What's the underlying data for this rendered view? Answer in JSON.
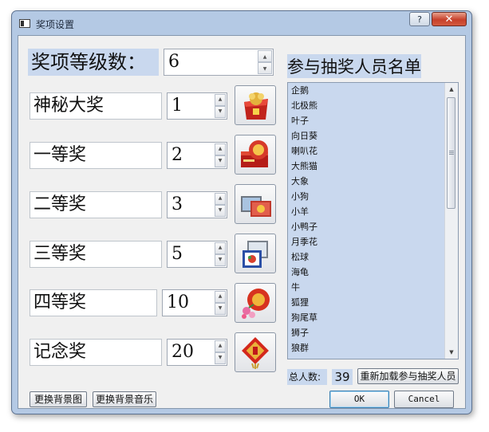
{
  "window": {
    "title": "奖项设置",
    "help": "?",
    "close": "✕"
  },
  "levels": {
    "label": "奖项等级数：",
    "value": "6"
  },
  "prizes": [
    {
      "name": "神秘大奖",
      "count": "1",
      "icon": "gift-basket-icon"
    },
    {
      "name": "一等奖",
      "count": "2",
      "icon": "red-envelope-icon"
    },
    {
      "name": "二等奖",
      "count": "3",
      "icon": "tv-set-icon"
    },
    {
      "name": "三等奖",
      "count": "5",
      "icon": "photo-frame-icon"
    },
    {
      "name": "四等奖",
      "count": "10",
      "icon": "red-ball-flowers-icon"
    },
    {
      "name": "记念奖",
      "count": "20",
      "icon": "fu-charm-icon"
    }
  ],
  "participants": {
    "title": "参与抽奖人员名单",
    "names": [
      "企鹅",
      "北极熊",
      "叶子",
      "向日葵",
      "喇叭花",
      "大熊猫",
      "大象",
      "小狗",
      "小羊",
      "小鸭子",
      "月季花",
      "松球",
      "海龟",
      "牛",
      "狐狸",
      "狗尾草",
      "狮子",
      "狼群"
    ],
    "total_label": "总人数:",
    "total_value": "39",
    "reload_button": "重新加载参与抽奖人员"
  },
  "buttons": {
    "change_background": "更换背景图",
    "change_music": "更换背景音乐",
    "ok": "OK",
    "cancel": "Cancel"
  },
  "colors": {
    "selection_blue": "#c9d8ee",
    "window_frame": "#b4c9e4",
    "close_red": "#c7402b"
  }
}
